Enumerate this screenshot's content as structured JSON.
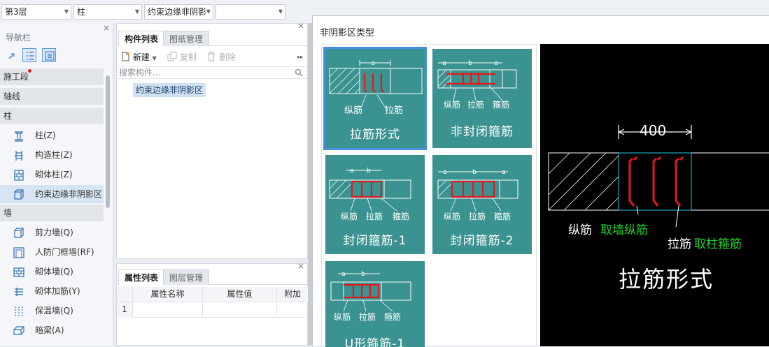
{
  "topbar": {
    "floor": "第3层",
    "category": "柱",
    "component": "约束边缘非阴影",
    "empty": ""
  },
  "nav": {
    "title": "导航栏",
    "close": "×",
    "sections": {
      "construction": "施工段",
      "axis": "轴线",
      "column": "柱",
      "wall": "墙"
    },
    "column_items": [
      "柱(Z)",
      "构造柱(Z)",
      "砌体柱(Z)",
      "约束边缘非阴影区"
    ],
    "wall_items": [
      "剪力墙(Q)",
      "人防门框墙(RF)",
      "砌体墙(Q)",
      "砌体加筋(Y)",
      "保温墙(Q)",
      "暗梁(A)"
    ]
  },
  "component_panel": {
    "tabs": [
      "构件列表",
      "图纸管理"
    ],
    "close": "×",
    "new_label": "新建",
    "copy_label": "复制",
    "delete_label": "删除",
    "more": "▸▸",
    "search_placeholder": "搜索构件...",
    "item": "约束边缘非阴影区"
  },
  "property_panel": {
    "tabs": [
      "属性列表",
      "图层管理"
    ],
    "close": "×",
    "columns": [
      "属性名称",
      "属性值",
      "附加"
    ],
    "rows": [
      {
        "index": "1",
        "name": "",
        "value": "",
        "extra": ""
      }
    ]
  },
  "dialog": {
    "title": "非阴影区类型",
    "types": [
      {
        "label": "拉筋形式",
        "selected": true,
        "dims": [
          "a"
        ],
        "notes": [
          "纵筋",
          "拉筋"
        ]
      },
      {
        "label": "非封闭箍筋",
        "selected": false,
        "dims": [
          "a",
          "b",
          "a"
        ],
        "notes": [
          "纵筋",
          "拉筋",
          "箍筋"
        ]
      },
      {
        "label": "封闭箍筋-1",
        "selected": false,
        "dims": [
          "a",
          "b"
        ],
        "notes": [
          "纵筋",
          "拉筋",
          "箍筋"
        ]
      },
      {
        "label": "封闭箍筋-2",
        "selected": false,
        "dims": [
          "a",
          "b",
          "a"
        ],
        "notes": [
          "纵筋",
          "拉筋",
          "箍筋"
        ]
      },
      {
        "label": "U形箍筋-1",
        "selected": false,
        "dims": [
          "a",
          "b"
        ],
        "notes": [
          "纵筋",
          "拉筋",
          "箍筋"
        ]
      }
    ],
    "preview": {
      "dimension": "400",
      "long_bar_label": "纵筋",
      "long_bar_value": "取墙纵筋",
      "tie_label": "拉筋",
      "tie_value": "取柱箍筋",
      "caption": "拉筋形式"
    }
  },
  "colors": {
    "thumb_bg": "#3a9391",
    "selected_border": "#4a90e2",
    "rebar_red": "#e31a1a",
    "preview_bg": "#000000",
    "preview_green": "#22d32a",
    "preview_cyan": "#22c7e8"
  }
}
